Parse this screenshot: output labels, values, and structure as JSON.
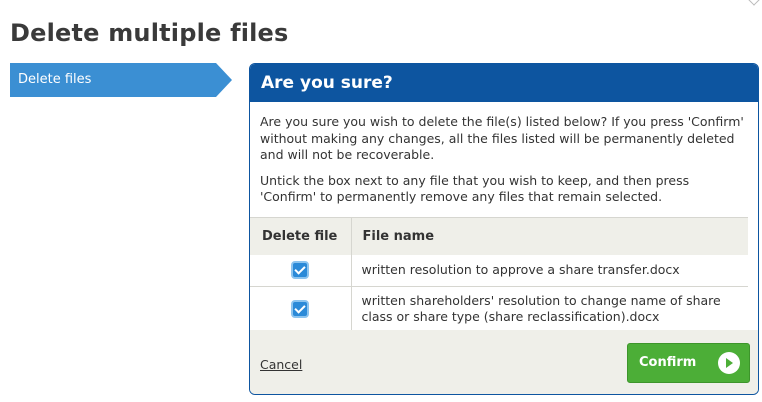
{
  "page": {
    "title": "Delete multiple files"
  },
  "nav": {
    "step_label": "Delete files"
  },
  "dialog": {
    "header": "Are you sure?",
    "paragraph_1": "Are you sure you wish to delete the file(s) listed below? If you press 'Confirm' without making any changes, all the files listed will be permanently deleted and will not be recoverable.",
    "paragraph_2": "Untick the box next to any file that you wish to keep, and then press 'Confirm' to permanently remove any files that remain selected.",
    "table": {
      "columns": [
        "Delete file",
        "File name"
      ],
      "rows": [
        {
          "checked": true,
          "file_name": "written resolution to approve a share transfer.docx"
        },
        {
          "checked": true,
          "file_name": "written shareholders' resolution to change name of share class or share type (share reclassification).docx"
        }
      ]
    },
    "footer": {
      "cancel_label": "Cancel",
      "confirm_label": "Confirm"
    }
  },
  "colors": {
    "header_blue": "#0d55a0",
    "step_blue": "#3b8fd3",
    "confirm_green": "#4cae37",
    "footer_bg": "#efefe9"
  }
}
